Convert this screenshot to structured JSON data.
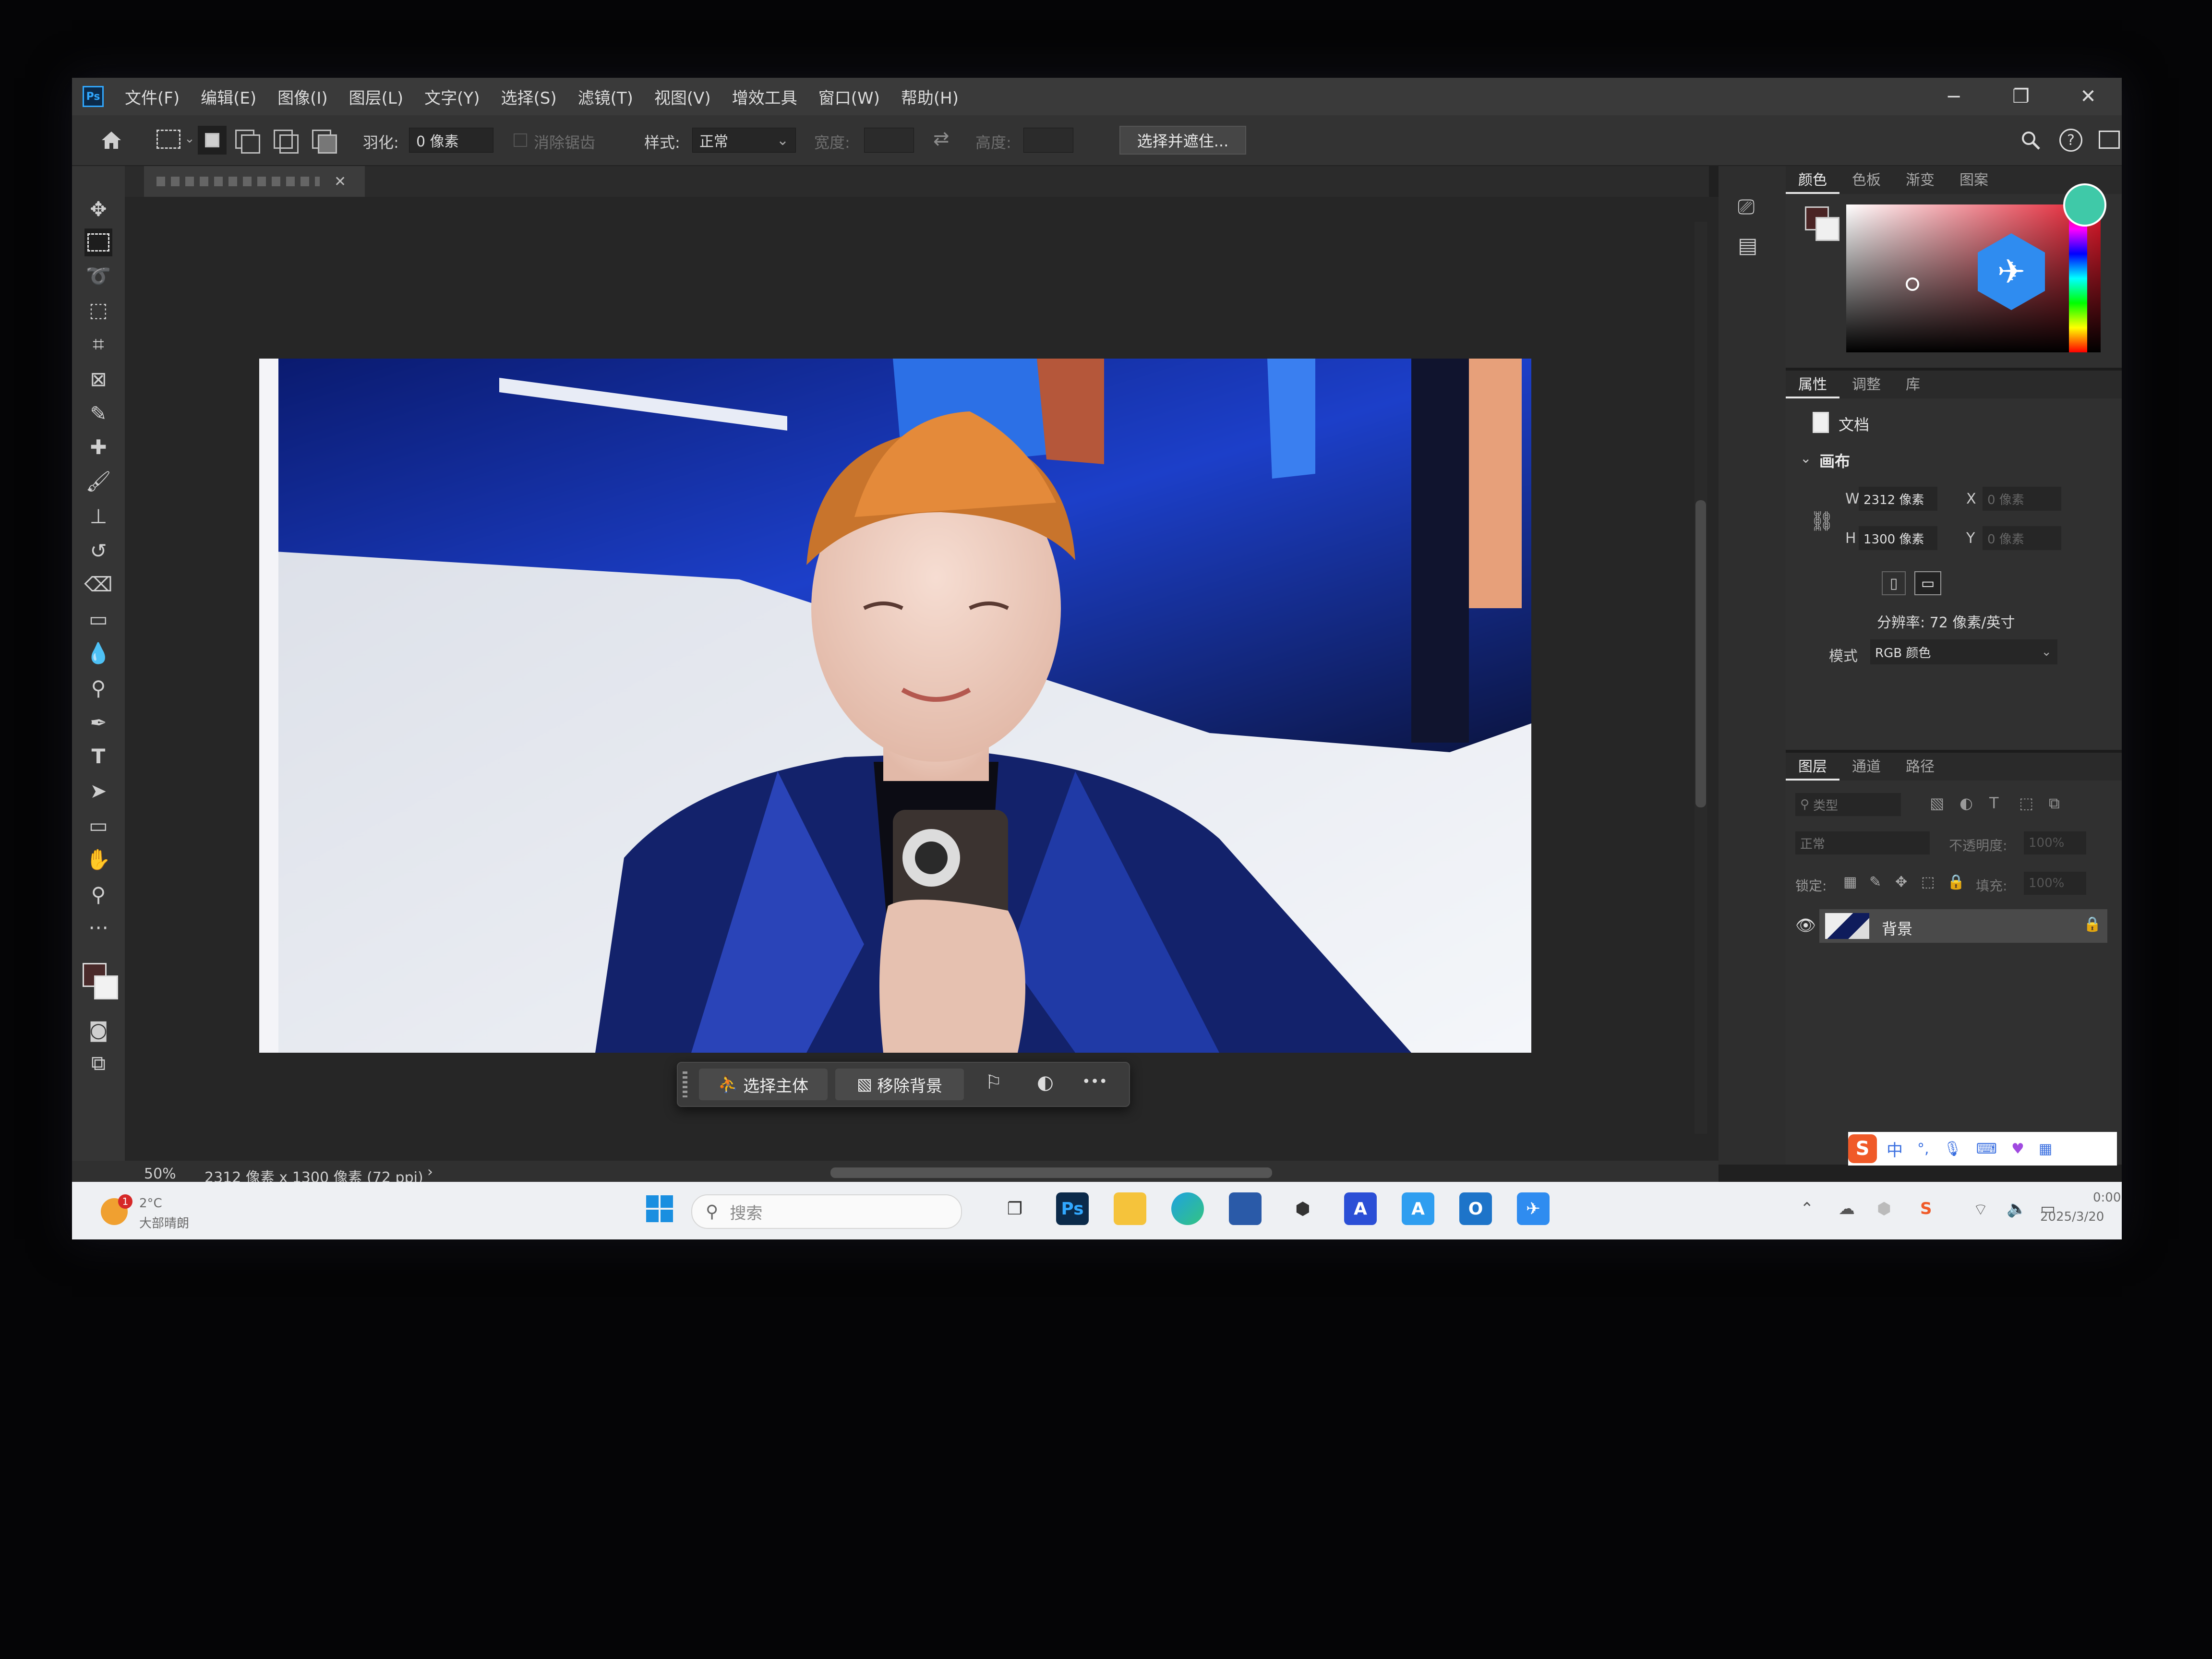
{
  "menu": [
    "文件(F)",
    "编辑(E)",
    "图像(I)",
    "图层(L)",
    "文字(Y)",
    "选择(S)",
    "滤镜(T)",
    "视图(V)",
    "增效工具",
    "窗口(W)",
    "帮助(H)"
  ],
  "app_icon": "Ps",
  "window_controls": {
    "minimize": "−",
    "restore": "❐",
    "close": "✕"
  },
  "options": {
    "feather_label": "羽化:",
    "feather_value": "0 像素",
    "antialias_label": "消除锯齿",
    "style_label": "样式:",
    "style_value": "正常",
    "width_label": "宽度:",
    "height_label": "高度:",
    "select_mask_button": "选择并遮住..."
  },
  "doc_tab": {
    "close": "✕"
  },
  "status": {
    "zoom": "50%",
    "info": "2312 像素 x 1300 像素 (72 ppi)",
    "arrow": "›"
  },
  "color_panel": {
    "tabs": [
      "颜色",
      "色板",
      "渐变",
      "图案"
    ]
  },
  "properties_panel": {
    "tabs": [
      "属性",
      "调整",
      "库"
    ],
    "doc_label": "文档",
    "section": "画布",
    "w_label": "W",
    "w_value": "2312 像素",
    "h_label": "H",
    "h_value": "1300 像素",
    "x_label": "X",
    "x_value": "0 像素",
    "y_label": "Y",
    "y_value": "0 像素",
    "resolution": "分辨率: 72 像素/英寸",
    "mode_label": "模式",
    "mode_value": "RGB 颜色"
  },
  "layers_panel": {
    "tabs": [
      "图层",
      "通道",
      "路径"
    ],
    "filter_placeholder": "类型",
    "blend_mode": "正常",
    "opacity_label": "不透明度:",
    "opacity_value": "100%",
    "lock_label": "锁定:",
    "fill_label": "填充:",
    "fill_value": "100%",
    "layer_name": "背景"
  },
  "context_bar": {
    "select_subject": "选择主体",
    "remove_bg": "移除背景",
    "more": "•••"
  },
  "taskbar": {
    "weather_temp": "2°C",
    "weather_desc": "大部晴朗",
    "weather_badge": "1",
    "search_placeholder": "搜索",
    "ps_label": "Ps",
    "time": "0:00",
    "date": "2025/3/20"
  },
  "ime": {
    "logo": "S",
    "lang": "中"
  },
  "colors": {
    "accent": "#31a8ff",
    "ui_dark": "#303030",
    "taskbar": "#eef0f3"
  }
}
